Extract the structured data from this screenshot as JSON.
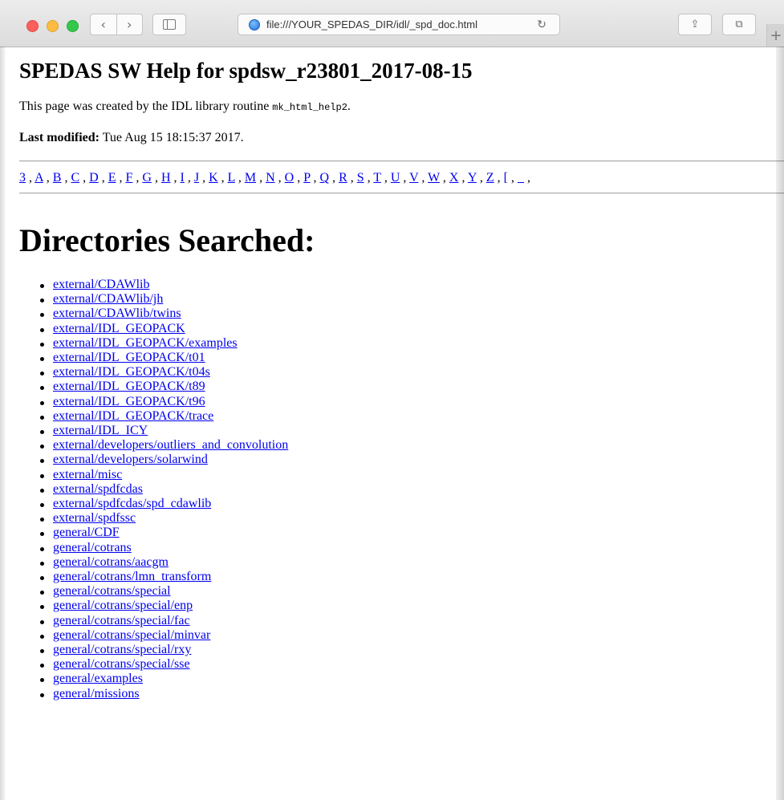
{
  "toolbar": {
    "back_icon": "‹",
    "forward_icon": "›",
    "address": "file:///YOUR_SPEDAS_DIR/idl/_spd_doc.html",
    "reload_icon": "↻",
    "share_icon": "⇪",
    "tabs_icon": "⧉",
    "new_tab_icon": "+"
  },
  "page": {
    "title": "SPEDAS SW Help for spdsw_r23801_2017-08-15",
    "created_prefix": "This page was created by the IDL library routine ",
    "created_routine": "mk_html_help2",
    "created_suffix": ".",
    "modified_label": "Last modified:",
    "modified_value": " Tue Aug 15 18:15:37 2017.",
    "letters": [
      "3",
      "A",
      "B",
      "C",
      "D",
      "E",
      "F",
      "G",
      "H",
      "I",
      "J",
      "K",
      "L",
      "M",
      "N",
      "O",
      "P",
      "Q",
      "R",
      "S",
      "T",
      "U",
      "V",
      "W",
      "X",
      "Y",
      "Z",
      "[",
      "_"
    ],
    "directories_heading": "Directories Searched:",
    "directories": [
      "external/CDAWlib",
      "external/CDAWlib/jh",
      "external/CDAWlib/twins",
      "external/IDL_GEOPACK",
      "external/IDL_GEOPACK/examples",
      "external/IDL_GEOPACK/t01",
      "external/IDL_GEOPACK/t04s",
      "external/IDL_GEOPACK/t89",
      "external/IDL_GEOPACK/t96",
      "external/IDL_GEOPACK/trace",
      "external/IDL_ICY",
      "external/developers/outliers_and_convolution",
      "external/developers/solarwind",
      "external/misc",
      "external/spdfcdas",
      "external/spdfcdas/spd_cdawlib",
      "external/spdfssc",
      "general/CDF",
      "general/cotrans",
      "general/cotrans/aacgm",
      "general/cotrans/lmn_transform",
      "general/cotrans/special",
      "general/cotrans/special/enp",
      "general/cotrans/special/fac",
      "general/cotrans/special/minvar",
      "general/cotrans/special/rxy",
      "general/cotrans/special/sse",
      "general/examples",
      "general/missions"
    ]
  }
}
